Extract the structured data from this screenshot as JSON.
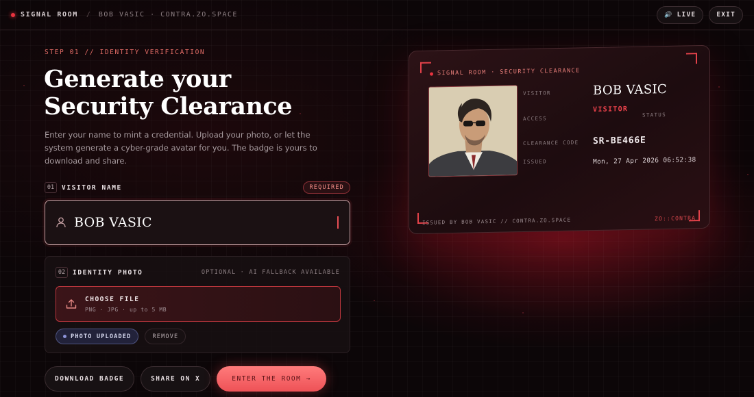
{
  "header": {
    "brand": "SIGNAL ROOM",
    "separator": "/",
    "breadcrumb": "BOB VASIC · CONTRA.ZO.SPACE",
    "live_label": "LIVE",
    "exit_label": "EXIT"
  },
  "intro": {
    "step": "STEP 01 // IDENTITY VERIFICATION",
    "title": "Generate your Security Clearance",
    "description": "Enter your name to mint a credential. Upload your photo, or let the system generate a cyber-grade avatar for you. The badge is yours to download and share."
  },
  "visitor_name": {
    "number": "01",
    "label": "VISITOR NAME",
    "required_badge": "REQUIRED",
    "value": "BOB VASIC"
  },
  "identity_photo": {
    "number": "02",
    "label": "IDENTITY PHOTO",
    "hint": "OPTIONAL · AI FALLBACK AVAILABLE",
    "choose_file_label": "CHOOSE FILE",
    "choose_file_sub": "PNG · JPG · up to 5 MB",
    "uploaded_label": "PHOTO UPLOADED",
    "remove_label": "REMOVE"
  },
  "actions": {
    "download": "DOWNLOAD BADGE",
    "share": "SHARE ON X",
    "enter": "ENTER THE ROOM →"
  },
  "badge": {
    "header": "SIGNAL ROOM · SECURITY CLEARANCE",
    "visitor_label": "VISITOR",
    "visitor_name": "BOB VASIC",
    "access_label": "ACCESS",
    "access_value": "VISITOR",
    "status_label": "STATUS",
    "code_label": "CLEARANCE CODE",
    "code_value": "SR-BE466E",
    "issued_label": "ISSUED",
    "issued_value": "Mon, 27 Apr 2026 06:52:38",
    "footer_left": "ISSUED BY BOB VASIC // CONTRA.ZO.SPACE",
    "footer_right": "ZO::CONTRA"
  },
  "colors": {
    "accent": "#e8333f",
    "primary_button": "#ee5257",
    "background": "#0c0608"
  }
}
